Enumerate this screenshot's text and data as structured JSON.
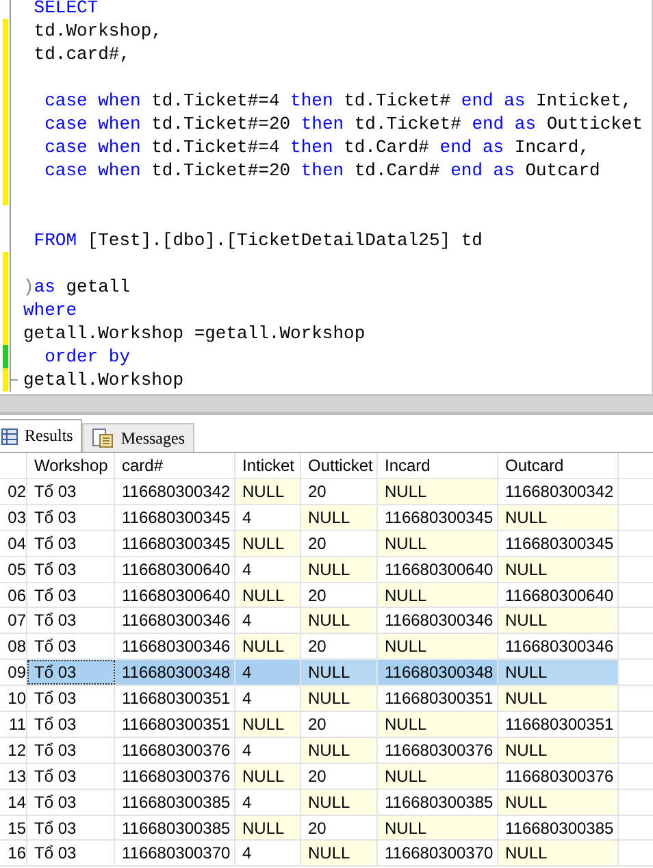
{
  "editor": {
    "lines": [
      {
        "changed": false,
        "segments": [
          {
            "kind": "keyword",
            "text": " SELECT"
          }
        ]
      },
      {
        "changed": true,
        "saved": false,
        "segments": [
          {
            "kind": "plain",
            "text": " td.Workshop,"
          }
        ]
      },
      {
        "changed": true,
        "saved": false,
        "segments": [
          {
            "kind": "plain",
            "text": " td.card#,"
          }
        ]
      },
      {
        "changed": true,
        "saved": false
      },
      {
        "changed": true,
        "saved": false,
        "segments": [
          {
            "kind": "keyword",
            "text": "  case when"
          },
          {
            "kind": "plain",
            "text": " td.Ticket#=4 "
          },
          {
            "kind": "keyword",
            "text": "then"
          },
          {
            "kind": "plain",
            "text": " td.Ticket# "
          },
          {
            "kind": "keyword",
            "text": "end as"
          },
          {
            "kind": "plain",
            "text": " Inticket,"
          }
        ]
      },
      {
        "changed": true,
        "saved": false,
        "segments": [
          {
            "kind": "keyword",
            "text": "  case when"
          },
          {
            "kind": "plain",
            "text": " td.Ticket#=20 "
          },
          {
            "kind": "keyword",
            "text": "then"
          },
          {
            "kind": "plain",
            "text": " td.Ticket# "
          },
          {
            "kind": "keyword",
            "text": "end as"
          },
          {
            "kind": "plain",
            "text": " Outticket"
          }
        ]
      },
      {
        "changed": true,
        "saved": false,
        "segments": [
          {
            "kind": "keyword",
            "text": "  case when"
          },
          {
            "kind": "plain",
            "text": " td.Ticket#=4 "
          },
          {
            "kind": "keyword",
            "text": "then"
          },
          {
            "kind": "plain",
            "text": " td.Card# "
          },
          {
            "kind": "keyword",
            "text": "end as"
          },
          {
            "kind": "plain",
            "text": " Incard,"
          }
        ]
      },
      {
        "changed": true,
        "saved": false,
        "segments": [
          {
            "kind": "keyword",
            "text": "  case when"
          },
          {
            "kind": "plain",
            "text": " td.Ticket#=20 "
          },
          {
            "kind": "keyword",
            "text": "then"
          },
          {
            "kind": "plain",
            "text": " td.Card# "
          },
          {
            "kind": "keyword",
            "text": "end as"
          },
          {
            "kind": "plain",
            "text": " Outcard"
          }
        ]
      },
      {
        "changed": true,
        "saved": false
      },
      {
        "changed": false
      },
      {
        "changed": false,
        "segments": [
          {
            "kind": "keyword",
            "text": " FROM"
          },
          {
            "kind": "plain",
            "text": " [Test].[dbo].[TicketDetailDatal25] td"
          }
        ]
      },
      {
        "changed": true,
        "saved": false
      },
      {
        "changed": true,
        "saved": false,
        "segments": [
          {
            "kind": "punct",
            "text": ")"
          },
          {
            "kind": "keyword",
            "text": "as"
          },
          {
            "kind": "plain",
            "text": " getall"
          }
        ]
      },
      {
        "changed": true,
        "saved": false,
        "segments": [
          {
            "kind": "keyword",
            "text": "where"
          }
        ]
      },
      {
        "changed": true,
        "saved": false,
        "segments": [
          {
            "kind": "plain",
            "text": "getall.Workshop =getall.Workshop"
          }
        ]
      },
      {
        "changed": true,
        "saved": true,
        "segments": [
          {
            "kind": "keyword",
            "text": "  order by"
          }
        ]
      },
      {
        "changed": true,
        "saved": false,
        "segments": [
          {
            "kind": "plain",
            "text": "getall.Workshop"
          }
        ]
      }
    ]
  },
  "tabs": [
    {
      "label": "Results",
      "selected": true,
      "kind": "grid"
    },
    {
      "label": "Messages",
      "selected": false,
      "kind": "messages"
    }
  ],
  "table": {
    "columns": [
      "Workshop",
      "card#",
      "Inticket",
      "Outticket",
      "Incard",
      "Outcard"
    ],
    "rows": [
      {
        "number": "02",
        "selected": false,
        "cells": [
          {
            "text": "Tổ 03",
            "null": false
          },
          {
            "text": "116680300342",
            "null": false
          },
          {
            "text": "NULL",
            "null": true
          },
          {
            "text": "20",
            "null": false
          },
          {
            "text": "NULL",
            "null": true
          },
          {
            "text": "116680300342",
            "null": false
          }
        ]
      },
      {
        "number": "03",
        "selected": false,
        "cells": [
          {
            "text": "Tổ 03",
            "null": false
          },
          {
            "text": "116680300345",
            "null": false
          },
          {
            "text": "4",
            "null": false
          },
          {
            "text": "NULL",
            "null": true
          },
          {
            "text": "116680300345",
            "null": false
          },
          {
            "text": "NULL",
            "null": true
          }
        ]
      },
      {
        "number": "04",
        "selected": false,
        "cells": [
          {
            "text": "Tổ 03",
            "null": false
          },
          {
            "text": "116680300345",
            "null": false
          },
          {
            "text": "NULL",
            "null": true
          },
          {
            "text": "20",
            "null": false
          },
          {
            "text": "NULL",
            "null": true
          },
          {
            "text": "116680300345",
            "null": false
          }
        ]
      },
      {
        "number": "05",
        "selected": false,
        "cells": [
          {
            "text": "Tổ 03",
            "null": false
          },
          {
            "text": "116680300640",
            "null": false
          },
          {
            "text": "4",
            "null": false
          },
          {
            "text": "NULL",
            "null": true
          },
          {
            "text": "116680300640",
            "null": false
          },
          {
            "text": "NULL",
            "null": true
          }
        ]
      },
      {
        "number": "06",
        "selected": false,
        "cells": [
          {
            "text": "Tổ 03",
            "null": false
          },
          {
            "text": "116680300640",
            "null": false
          },
          {
            "text": "NULL",
            "null": true
          },
          {
            "text": "20",
            "null": false
          },
          {
            "text": "NULL",
            "null": true
          },
          {
            "text": "116680300640",
            "null": false
          }
        ]
      },
      {
        "number": "07",
        "selected": false,
        "cells": [
          {
            "text": "Tổ 03",
            "null": false
          },
          {
            "text": "116680300346",
            "null": false
          },
          {
            "text": "4",
            "null": false
          },
          {
            "text": "NULL",
            "null": true
          },
          {
            "text": "116680300346",
            "null": false
          },
          {
            "text": "NULL",
            "null": true
          }
        ]
      },
      {
        "number": "08",
        "selected": false,
        "cells": [
          {
            "text": "Tổ 03",
            "null": false
          },
          {
            "text": "116680300346",
            "null": false
          },
          {
            "text": "NULL",
            "null": true
          },
          {
            "text": "20",
            "null": false
          },
          {
            "text": "NULL",
            "null": true
          },
          {
            "text": "116680300346",
            "null": false
          }
        ]
      },
      {
        "number": "09",
        "selected": true,
        "cells": [
          {
            "text": "Tổ 03",
            "null": false
          },
          {
            "text": "116680300348",
            "null": false
          },
          {
            "text": "4",
            "null": false
          },
          {
            "text": "NULL",
            "null": true
          },
          {
            "text": "116680300348",
            "null": false
          },
          {
            "text": "NULL",
            "null": true
          }
        ]
      },
      {
        "number": "10",
        "selected": false,
        "cells": [
          {
            "text": "Tổ 03",
            "null": false
          },
          {
            "text": "116680300351",
            "null": false
          },
          {
            "text": "4",
            "null": false
          },
          {
            "text": "NULL",
            "null": true
          },
          {
            "text": "116680300351",
            "null": false
          },
          {
            "text": "NULL",
            "null": true
          }
        ]
      },
      {
        "number": "11",
        "selected": false,
        "cells": [
          {
            "text": "Tổ 03",
            "null": false
          },
          {
            "text": "116680300351",
            "null": false
          },
          {
            "text": "NULL",
            "null": true
          },
          {
            "text": "20",
            "null": false
          },
          {
            "text": "NULL",
            "null": true
          },
          {
            "text": "116680300351",
            "null": false
          }
        ]
      },
      {
        "number": "12",
        "selected": false,
        "cells": [
          {
            "text": "Tổ 03",
            "null": false
          },
          {
            "text": "116680300376",
            "null": false
          },
          {
            "text": "4",
            "null": false
          },
          {
            "text": "NULL",
            "null": true
          },
          {
            "text": "116680300376",
            "null": false
          },
          {
            "text": "NULL",
            "null": true
          }
        ]
      },
      {
        "number": "13",
        "selected": false,
        "cells": [
          {
            "text": "Tổ 03",
            "null": false
          },
          {
            "text": "116680300376",
            "null": false
          },
          {
            "text": "NULL",
            "null": true
          },
          {
            "text": "20",
            "null": false
          },
          {
            "text": "NULL",
            "null": true
          },
          {
            "text": "116680300376",
            "null": false
          }
        ]
      },
      {
        "number": "14",
        "selected": false,
        "cells": [
          {
            "text": "Tổ 03",
            "null": false
          },
          {
            "text": "116680300385",
            "null": false
          },
          {
            "text": "4",
            "null": false
          },
          {
            "text": "NULL",
            "null": true
          },
          {
            "text": "116680300385",
            "null": false
          },
          {
            "text": "NULL",
            "null": true
          }
        ]
      },
      {
        "number": "15",
        "selected": false,
        "cells": [
          {
            "text": "Tổ 03",
            "null": false
          },
          {
            "text": "116680300385",
            "null": false
          },
          {
            "text": "NULL",
            "null": true
          },
          {
            "text": "20",
            "null": false
          },
          {
            "text": "NULL",
            "null": true
          },
          {
            "text": "116680300385",
            "null": false
          }
        ]
      },
      {
        "number": "16",
        "selected": false,
        "cells": [
          {
            "text": "Tổ 03",
            "null": false
          },
          {
            "text": "116680300370",
            "null": false
          },
          {
            "text": "4",
            "null": false
          },
          {
            "text": "NULL",
            "null": true
          },
          {
            "text": "116680300370",
            "null": false
          },
          {
            "text": "NULL",
            "null": true
          }
        ]
      }
    ]
  }
}
